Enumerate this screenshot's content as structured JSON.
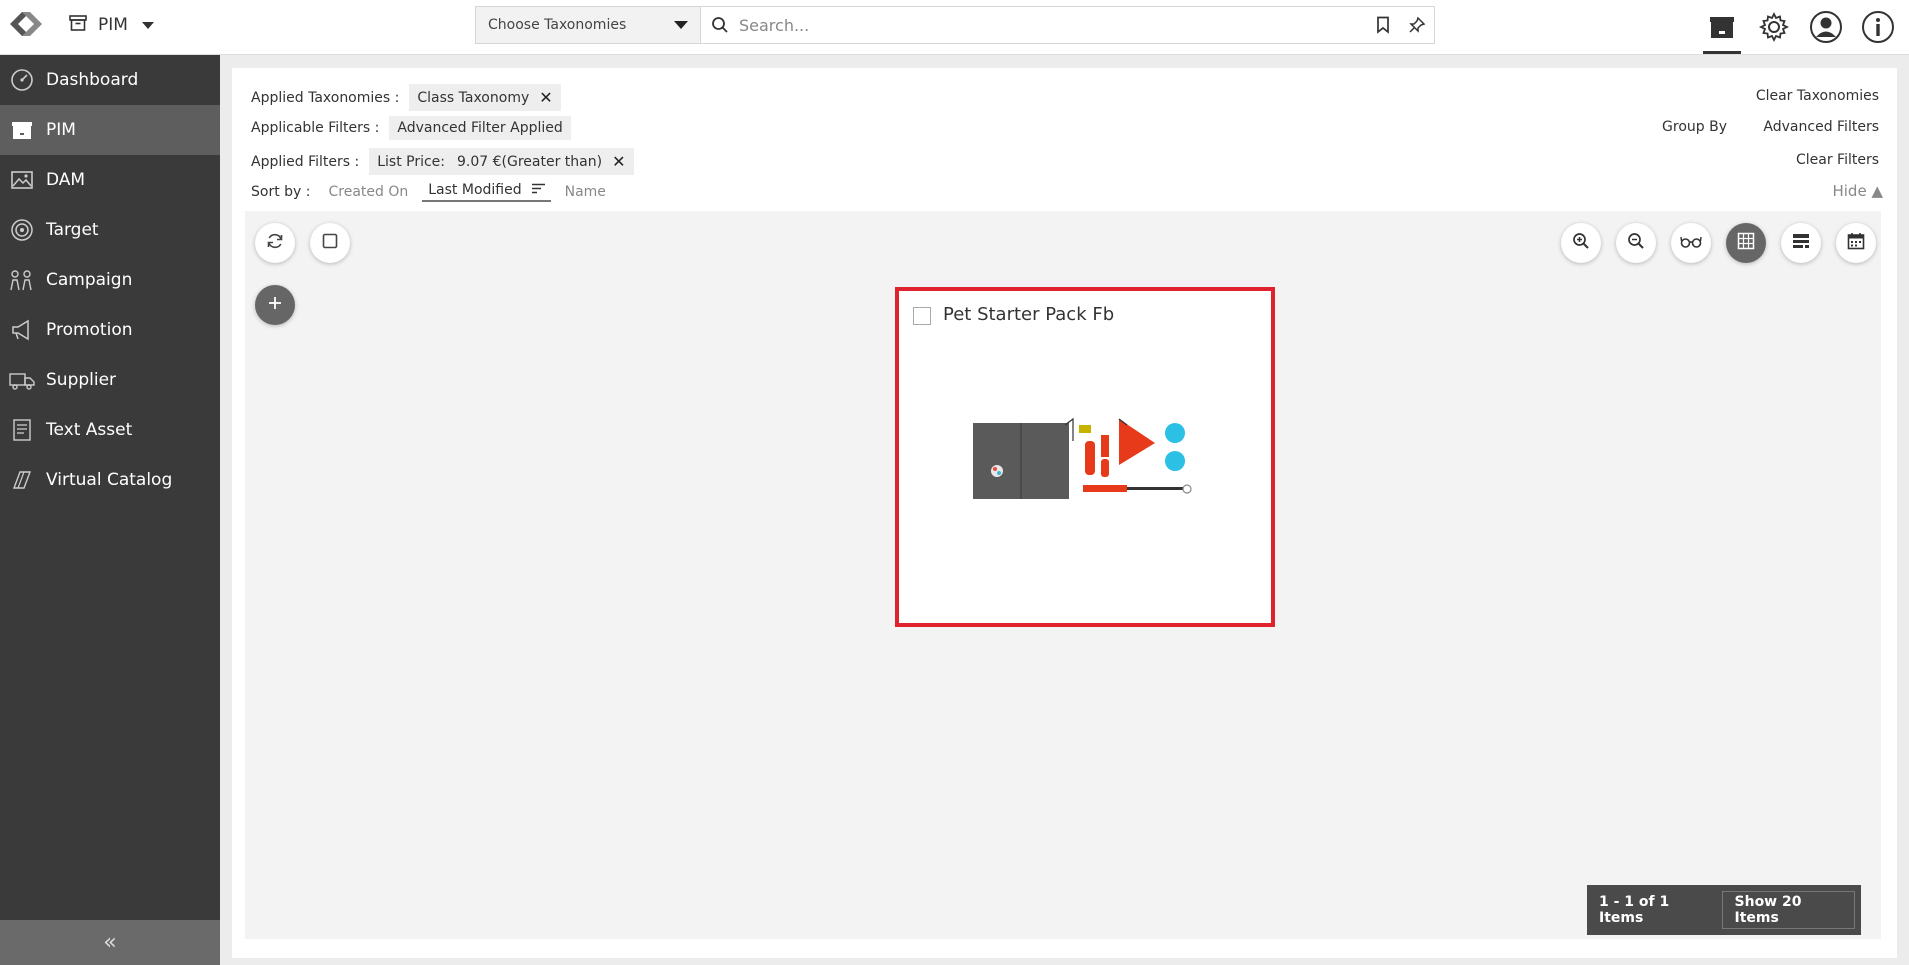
{
  "header": {
    "app_name": "PIM",
    "taxonomy_select": "Choose Taxonomies",
    "search_placeholder": "Search..."
  },
  "sidebar": {
    "items": [
      {
        "label": "Dashboard",
        "icon": "dashboard-icon"
      },
      {
        "label": "PIM",
        "icon": "pim-box-icon",
        "active": true
      },
      {
        "label": "DAM",
        "icon": "image-icon"
      },
      {
        "label": "Target",
        "icon": "target-icon"
      },
      {
        "label": "Campaign",
        "icon": "campaign-icon"
      },
      {
        "label": "Promotion",
        "icon": "megaphone-icon"
      },
      {
        "label": "Supplier",
        "icon": "truck-icon"
      },
      {
        "label": "Text Asset",
        "icon": "document-icon"
      },
      {
        "label": "Virtual Catalog",
        "icon": "catalog-icon"
      }
    ],
    "collapse_glyph": "«"
  },
  "filters": {
    "applied_taxonomies_label": "Applied Taxonomies :",
    "taxonomy_chip": "Class Taxonomy",
    "applicable_filters_label": "Applicable Filters :",
    "applicable_chip": "Advanced Filter Applied",
    "applied_filters_label": "Applied Filters :",
    "filter_chip_key": "List Price:",
    "filter_chip_value": "9.07 €(Greater than)",
    "clear_taxonomies": "Clear Taxonomies",
    "group_by": "Group By",
    "advanced_filters": "Advanced Filters",
    "clear_filters": "Clear Filters",
    "hide": "Hide ▲"
  },
  "sort": {
    "label": "Sort by :",
    "options": [
      "Created On",
      "Last Modified",
      "Name"
    ],
    "active": "Last Modified"
  },
  "card": {
    "title": "Pet Starter Pack Fb"
  },
  "pager": {
    "count": "1 - 1 of 1 Items",
    "show": "Show 20 Items"
  },
  "colors": {
    "sidebar_bg": "#3a3a3a",
    "sidebar_active": "#5e5e5e",
    "highlight_red": "#e0222e"
  }
}
